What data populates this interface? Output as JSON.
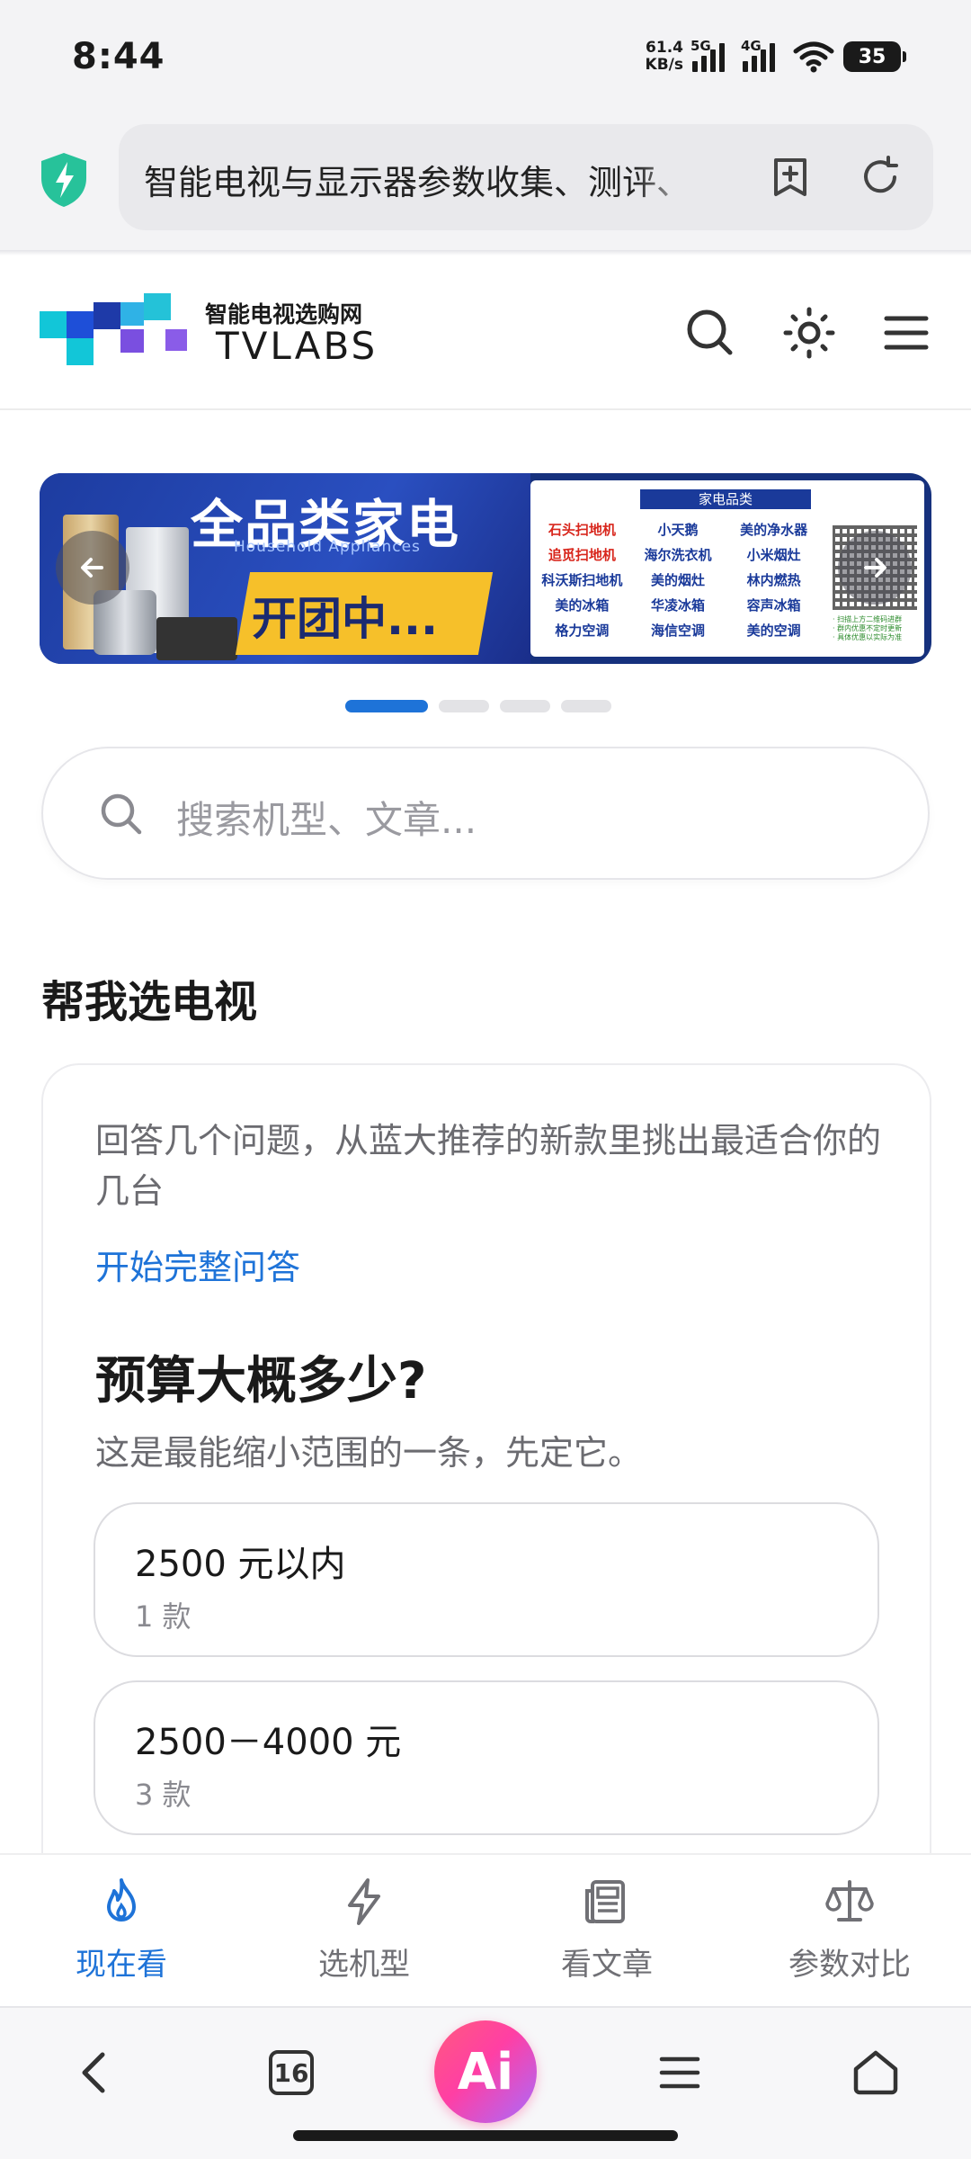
{
  "status_bar": {
    "time": "8:44",
    "net_speed_value": "61.4",
    "net_speed_unit": "KB/s",
    "sim1_tag": "5G",
    "sim2_tag": "4G",
    "battery": "35"
  },
  "browser": {
    "url_text": "智能电视与显示器参数收集、测评、",
    "tab_count": "16",
    "ai_label": "Ai"
  },
  "site": {
    "logo_cn": "智能电视选购网",
    "logo_en": "TVLABS"
  },
  "banner": {
    "title": "全品类家电",
    "subtitle": "Household Appliances",
    "tag": "开团中...",
    "list_header": "家电品类",
    "items": [
      "石头扫地机",
      "小天鹅",
      "美的净水器",
      "追觅扫地机",
      "海尔洗衣机",
      "小米烟灶",
      "科沃斯扫地机",
      "美的烟灶",
      "林内燃热",
      "美的冰箱",
      "华凌冰箱",
      "容声冰箱",
      "格力空调",
      "海信空调",
      "美的空调"
    ],
    "red_items": [
      0,
      3
    ],
    "qr_notes": [
      "· 扫描上方二维码进群",
      "· 群内优惠不定时更新",
      "· 具体优惠以实际为准"
    ],
    "slide_count": 4,
    "active_slide": 0
  },
  "search": {
    "placeholder": "搜索机型、文章..."
  },
  "picker": {
    "section_title": "帮我选电视",
    "description": "回答几个问题，从蓝大推荐的新款里挑出最适合你的几台",
    "start_link": "开始完整问答",
    "question": "预算大概多少?",
    "hint": "这是最能缩小范围的一条，先定它。",
    "options": [
      {
        "label": "2500 元以内",
        "count": "1 款"
      },
      {
        "label": "2500－4000 元",
        "count": "3 款"
      }
    ]
  },
  "site_nav": [
    {
      "label": "现在看",
      "icon": "flame-icon",
      "active": true
    },
    {
      "label": "选机型",
      "icon": "lightning-icon",
      "active": false
    },
    {
      "label": "看文章",
      "icon": "newspaper-icon",
      "active": false
    },
    {
      "label": "参数对比",
      "icon": "scale-icon",
      "active": false
    }
  ],
  "colors": {
    "accent": "#1e73d8",
    "text": "#1a1a1a",
    "muted": "#6b6b70",
    "banner_blue": "#1d3ca0",
    "banner_yellow": "#f6c02a"
  }
}
